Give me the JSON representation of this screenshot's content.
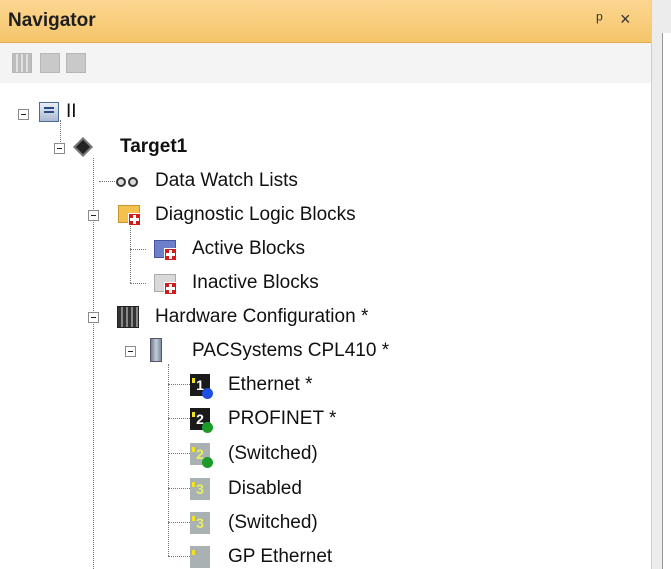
{
  "window": {
    "title": "Navigator",
    "pin_glyph": "\u0004",
    "close_glyph": "×"
  },
  "toolbar": {
    "icons": [
      "grid-view-icon",
      "list-view-icon",
      "detail-view-icon"
    ]
  },
  "tree": {
    "project": {
      "label": "II"
    },
    "target": {
      "label": "Target1"
    },
    "data_watch": {
      "label": "Data Watch Lists"
    },
    "diag_logic": {
      "label": "Diagnostic Logic Blocks"
    },
    "active_blocks": {
      "label": "Active Blocks"
    },
    "inactive_blocks": {
      "label": "Inactive Blocks"
    },
    "hw_config": {
      "label": "Hardware Configuration *"
    },
    "pac": {
      "label": "PACSystems CPL410 *"
    },
    "slots": [
      {
        "label": "Ethernet *",
        "num": "1",
        "dot": "#1e4fe0"
      },
      {
        "label": "PROFINET *",
        "num": "2",
        "dot": "#1c9a2a"
      },
      {
        "label": "(Switched)",
        "num": "2",
        "dot": "#1c9a2a"
      },
      {
        "label": "Disabled",
        "num": "3",
        "dot": ""
      },
      {
        "label": "(Switched)",
        "num": "3",
        "dot": ""
      },
      {
        "label": "GP Ethernet",
        "num": "",
        "dot": ""
      }
    ]
  },
  "colors": {
    "title_bar": "#f5c56b",
    "badge_red": "#d21c1c"
  }
}
